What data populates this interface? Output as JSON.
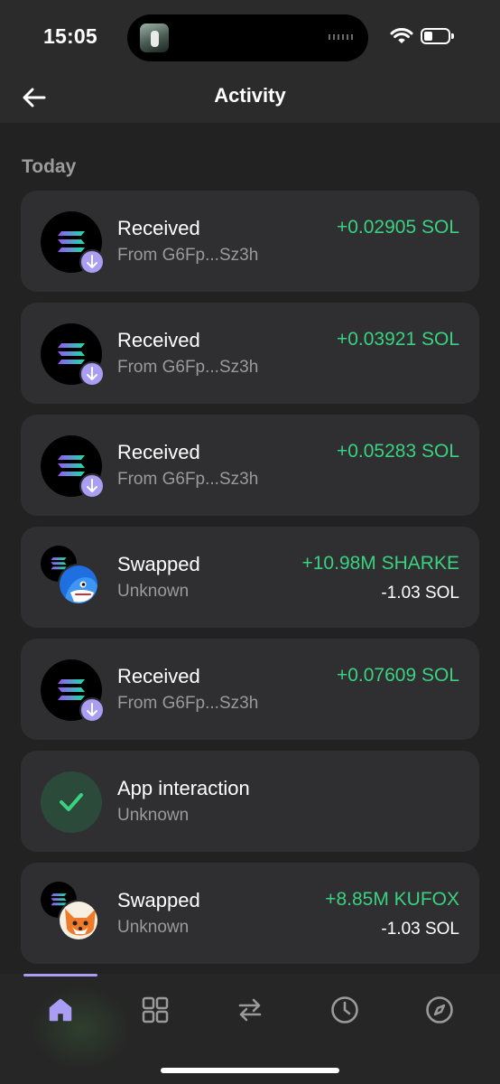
{
  "status_bar": {
    "time": "15:05"
  },
  "header": {
    "title": "Activity"
  },
  "section": {
    "label": "Today"
  },
  "transactions": [
    {
      "type": "received",
      "title": "Received",
      "subtitle": "From G6Fp...Sz3h",
      "amount": "+0.02905 SOL"
    },
    {
      "type": "received",
      "title": "Received",
      "subtitle": "From G6Fp...Sz3h",
      "amount": "+0.03921 SOL"
    },
    {
      "type": "received",
      "title": "Received",
      "subtitle": "From G6Fp...Sz3h",
      "amount": "+0.05283 SOL"
    },
    {
      "type": "swapped",
      "title": "Swapped",
      "subtitle": "Unknown",
      "amount": "+10.98M SHARKE",
      "amount_secondary": "-1.03 SOL",
      "token_icon": "shark-token-icon"
    },
    {
      "type": "received",
      "title": "Received",
      "subtitle": "From G6Fp...Sz3h",
      "amount": "+0.07609 SOL"
    },
    {
      "type": "app",
      "title": "App interaction",
      "subtitle": "Unknown"
    },
    {
      "type": "swapped",
      "title": "Swapped",
      "subtitle": "Unknown",
      "amount": "+8.85M KUFOX",
      "amount_secondary": "-1.03 SOL",
      "token_icon": "fox-token-icon"
    }
  ],
  "tabbar": {
    "items": [
      {
        "icon": "home-icon",
        "active": true
      },
      {
        "icon": "grid-icon",
        "active": false
      },
      {
        "icon": "swap-icon",
        "active": false
      },
      {
        "icon": "clock-icon",
        "active": false
      },
      {
        "icon": "compass-icon",
        "active": false
      }
    ]
  },
  "colors": {
    "positive": "#3ad180",
    "accent": "#a99ef4",
    "card": "#2f2f31",
    "background": "#222222"
  }
}
